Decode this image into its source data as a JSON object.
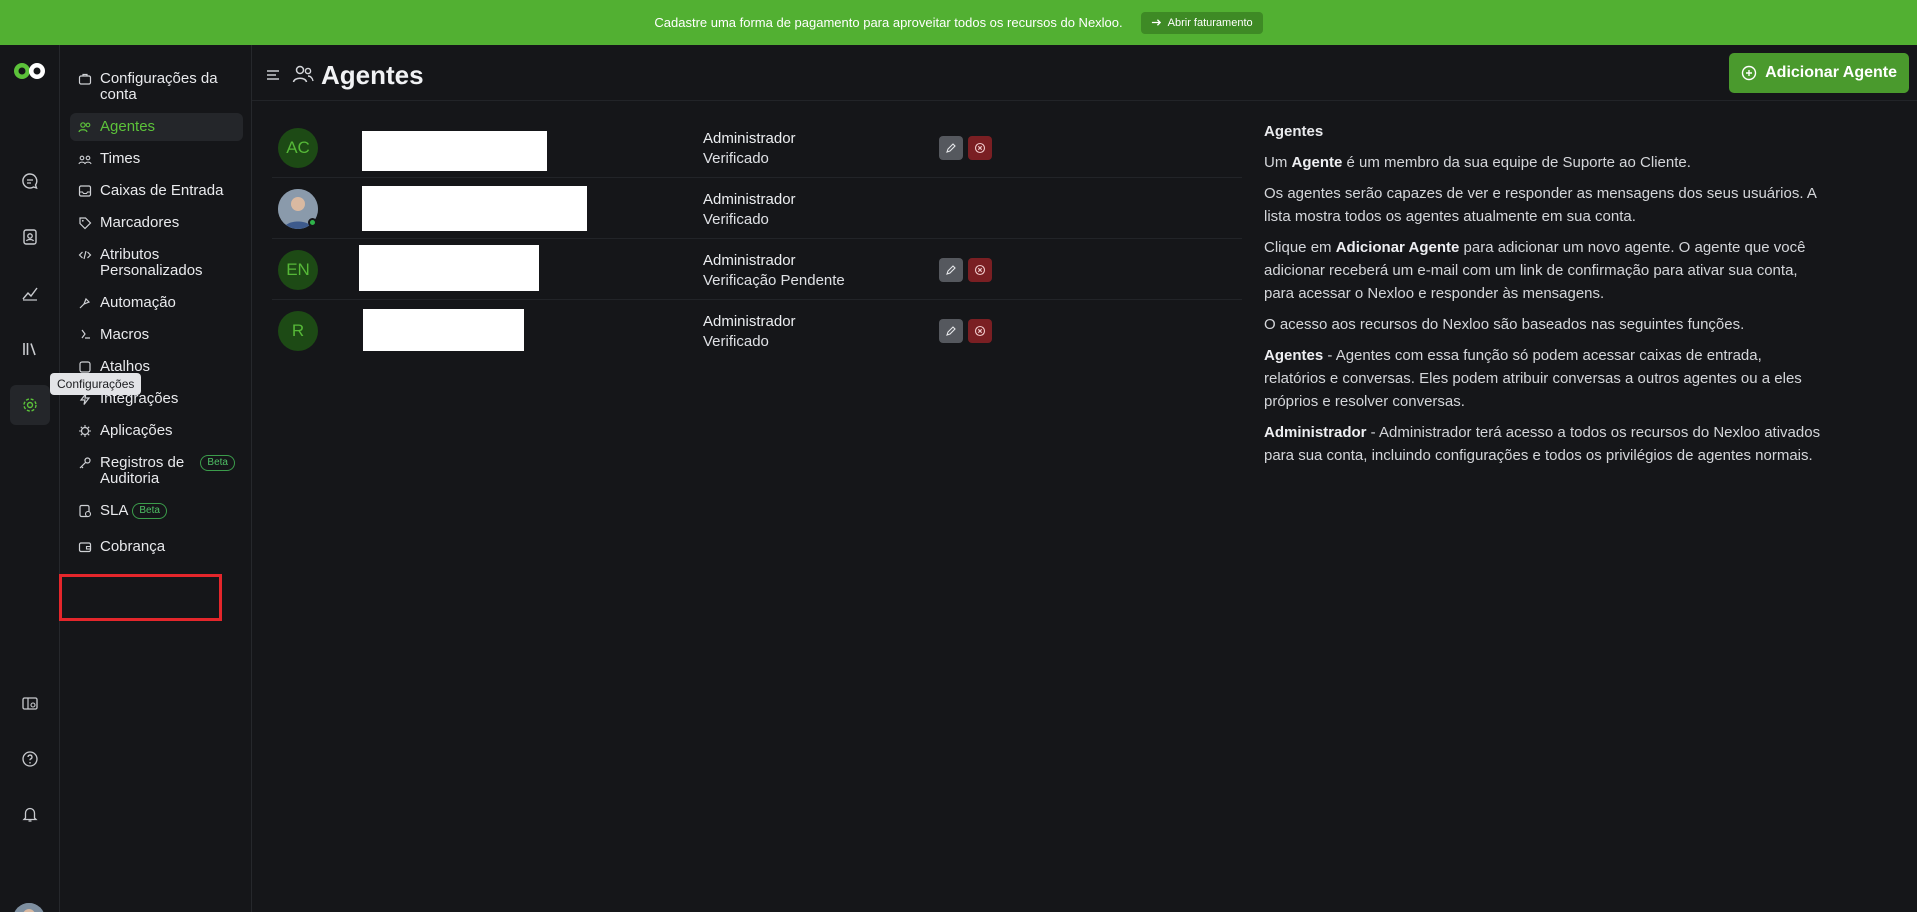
{
  "banner": {
    "message": "Cadastre uma forma de pagamento para aproveitar todos os recursos do Nexloo.",
    "button_label": "Abrir faturamento"
  },
  "rail": {
    "tooltip": "Configurações",
    "icons": [
      "chat-icon",
      "contacts-icon",
      "reports-icon",
      "library-icon",
      "settings-icon",
      "dashboard-icon",
      "help-icon",
      "bell-icon"
    ]
  },
  "sidebar": {
    "items": [
      {
        "label": "Configurações da conta",
        "icon": "briefcase-icon"
      },
      {
        "label": "Agentes",
        "icon": "users-icon",
        "active": true
      },
      {
        "label": "Times",
        "icon": "team-icon"
      },
      {
        "label": "Caixas de Entrada",
        "icon": "inbox-icon"
      },
      {
        "label": "Marcadores",
        "icon": "tag-icon"
      },
      {
        "label": "Atributos Personalizados",
        "icon": "code-icon"
      },
      {
        "label": "Automação",
        "icon": "automation-icon"
      },
      {
        "label": "Macros",
        "icon": "macro-icon"
      },
      {
        "label": "Atalhos",
        "icon": "shortcut-icon"
      },
      {
        "label": "Integrações",
        "icon": "bolt-icon"
      },
      {
        "label": "Aplicações",
        "icon": "apps-icon"
      },
      {
        "label": "Registros de Auditoria",
        "icon": "key-icon",
        "badge": "Beta"
      },
      {
        "label": "SLA",
        "icon": "sla-icon",
        "badge": "Beta"
      },
      {
        "label": "Cobrança",
        "icon": "wallet-icon"
      }
    ]
  },
  "header": {
    "title": "Agentes",
    "add_button": "Adicionar Agente"
  },
  "agents": [
    {
      "initials": "AC",
      "role": "Administrador",
      "status": "Verificado",
      "actions": true
    },
    {
      "initials": "",
      "role": "Administrador",
      "status": "Verificado",
      "actions": false
    },
    {
      "initials": "EN",
      "role": "Administrador",
      "status": "Verificação Pendente",
      "actions": true
    },
    {
      "initials": "R",
      "role": "Administrador",
      "status": "Verificado",
      "actions": true
    }
  ],
  "info": {
    "heading": "Agentes",
    "p1_pre": "Um ",
    "p1_bold": "Agente",
    "p1_post": " é um membro da sua equipe de Suporte ao Cliente.",
    "p2": "Os agentes serão capazes de ver e responder as mensagens dos seus usuários. A lista mostra todos os agentes atualmente em sua conta.",
    "p3_pre": "Clique em ",
    "p3_bold": "Adicionar Agente",
    "p3_post": " para adicionar um novo agente. O agente que você adicionar receberá um e-mail com um link de confirmação para ativar sua conta, para acessar o Nexloo e responder às mensagens.",
    "p4": "O acesso aos recursos do Nexloo são baseados nas seguintes funções.",
    "p5_bold": "Agentes",
    "p5_post": " - Agentes com essa função só podem acessar caixas de entrada, relatórios e conversas. Eles podem atribuir conversas a outros agentes ou a eles próprios e resolver conversas.",
    "p6_bold": "Administrador",
    "p6_post": " - Administrador terá acesso a todos os recursos do Nexloo ativados para sua conta, incluindo configurações e todos os privilégios de agentes normais."
  },
  "colors": {
    "brand_green": "#52b032",
    "background": "#151619",
    "highlight_red": "#e4262b"
  }
}
